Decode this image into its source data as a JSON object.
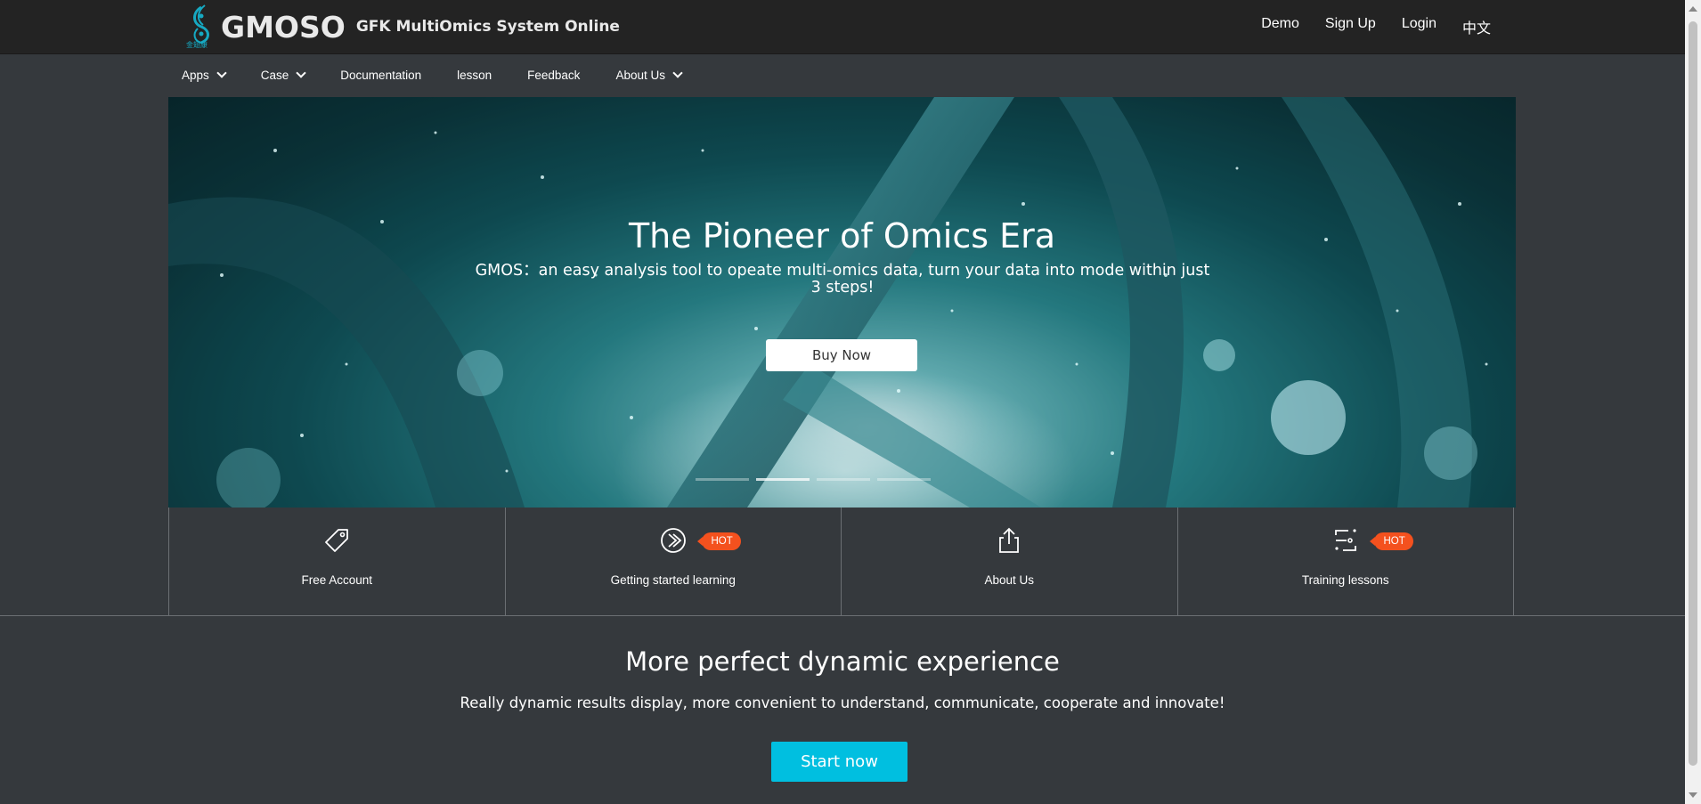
{
  "header": {
    "logo_text": "GMOSO",
    "logo_mark_text": "金翅康",
    "subtitle": "GFK MultiOmics System Online",
    "links": [
      "Demo",
      "Sign Up",
      "Login",
      "中文"
    ]
  },
  "nav": {
    "items": [
      {
        "label": "Apps",
        "dropdown": true
      },
      {
        "label": "Case",
        "dropdown": true
      },
      {
        "label": "Documentation",
        "dropdown": false
      },
      {
        "label": "lesson",
        "dropdown": false
      },
      {
        "label": "Feedback",
        "dropdown": false
      },
      {
        "label": "About Us",
        "dropdown": true
      }
    ]
  },
  "hero": {
    "title": "The Pioneer of Omics Era",
    "subtitle": "GMOS：an easy analysis tool to opeate multi-omics data, turn your data into mode within just 3 steps!",
    "button": "Buy Now",
    "slide_count": 4,
    "active_slide": 1
  },
  "features": [
    {
      "label": "Free Account",
      "icon": "tag-icon",
      "hot": false
    },
    {
      "label": "Getting started learning",
      "icon": "learning-icon",
      "hot": true
    },
    {
      "label": "About Us",
      "icon": "share-icon",
      "hot": false
    },
    {
      "label": "Training lessons",
      "icon": "lessons-icon",
      "hot": true
    }
  ],
  "hot_label": "HOT",
  "section": {
    "title": "More perfect dynamic experience",
    "subtitle": "Really dynamic results display, more convenient to understand, communicate, cooperate and innovate!",
    "button": "Start now"
  },
  "colors": {
    "topbar": "#232323",
    "page": "#35393d",
    "hot": "#f4511e",
    "accent": "#00bfe0",
    "logo": "#16a9c2"
  }
}
